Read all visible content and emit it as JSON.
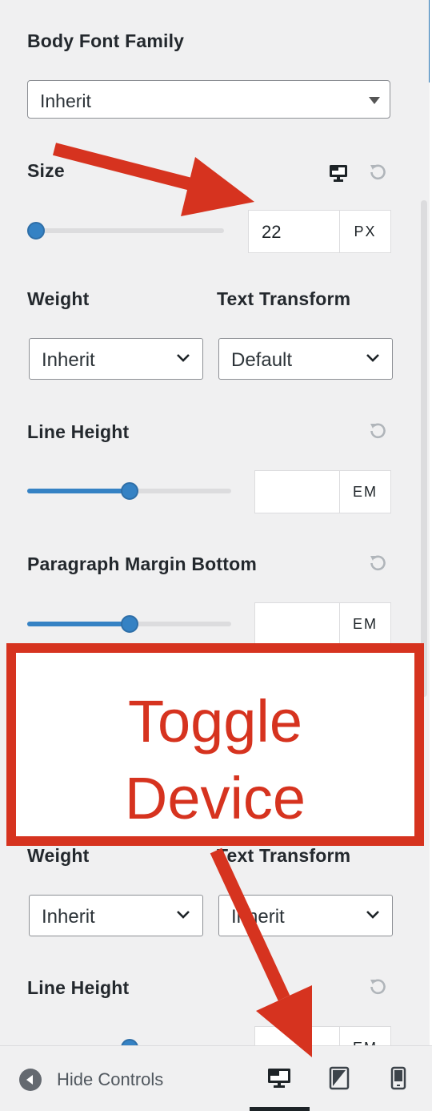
{
  "body_font_family": {
    "label": "Body Font Family",
    "value": "Inherit"
  },
  "size": {
    "label": "Size",
    "value": "22",
    "unit": "PX",
    "slider_fraction": 0.05
  },
  "weight": {
    "label": "Weight",
    "value": "Inherit"
  },
  "text_transform": {
    "label": "Text Transform",
    "value": "Default"
  },
  "line_height": {
    "label": "Line Height",
    "value": "",
    "unit": "EM",
    "slider_fraction": 0.5
  },
  "paragraph_margin": {
    "label": "Paragraph Margin Bottom",
    "value": "",
    "unit": "EM",
    "slider_fraction": 0.5
  },
  "second_group": {
    "weight_label": "Weight",
    "weight_value": "Inherit",
    "text_transform_label": "Text Transform",
    "text_transform_value": "Inherit",
    "line_height_label": "Line Height",
    "unit": "EM"
  },
  "callout": {
    "line1": "Toggle",
    "line2": "Device"
  },
  "footer": {
    "hide_controls_label": "Hide Controls",
    "devices": [
      "desktop-icon",
      "tablet-icon",
      "mobile-icon"
    ],
    "active_device": "desktop"
  },
  "colors": {
    "accent": "#3582c4",
    "annotation": "#d6331f",
    "background": "#f0f0f1"
  }
}
